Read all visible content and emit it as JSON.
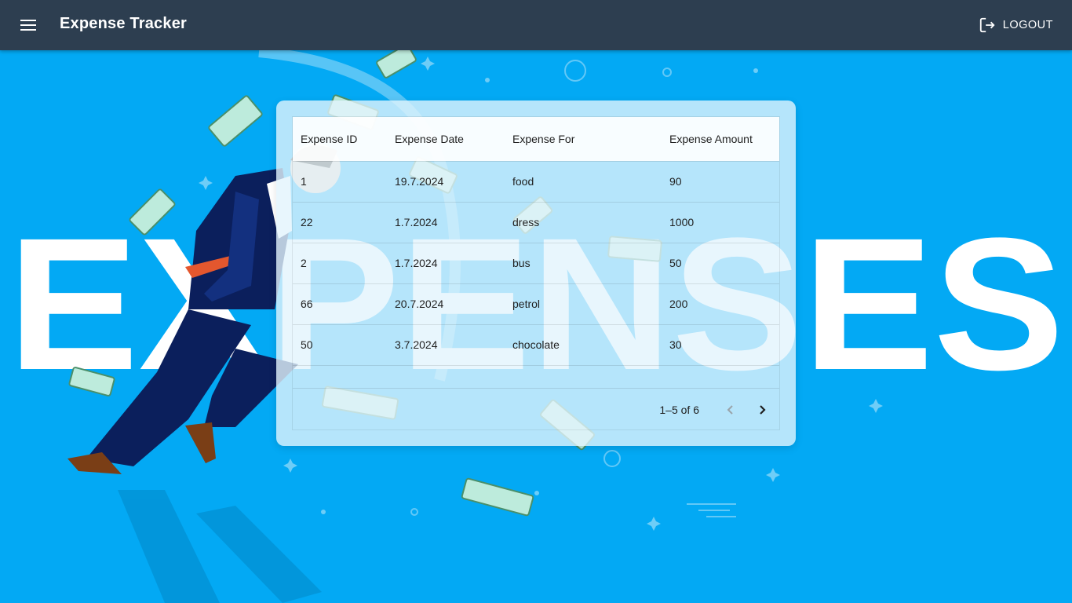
{
  "app": {
    "title": "Expense Tracker",
    "logout_label": "LOGOUT"
  },
  "background": {
    "headline": "EXPENSES"
  },
  "table": {
    "columns": [
      "Expense ID",
      "Expense Date",
      "Expense For",
      "Expense Amount"
    ],
    "rows": [
      [
        "1",
        "19.7.2024",
        "food",
        "90"
      ],
      [
        "22",
        "1.7.2024",
        "dress",
        "1000"
      ],
      [
        "2",
        "1.7.2024",
        "bus",
        "50"
      ],
      [
        "66",
        "20.7.2024",
        "petrol",
        "200"
      ],
      [
        "50",
        "3.7.2024",
        "chocolate",
        "30"
      ]
    ],
    "pagination": {
      "label": "1–5 of 6"
    }
  },
  "icons": {
    "menu": "menu-icon",
    "logout": "logout-icon",
    "prev": "chevron-left-icon",
    "next": "chevron-right-icon"
  },
  "colors": {
    "appbar": "#2d3e50",
    "background": "#03a9f4",
    "headline": "#ffffff",
    "suit": "#0b1f5c",
    "tie": "#e4572e"
  }
}
